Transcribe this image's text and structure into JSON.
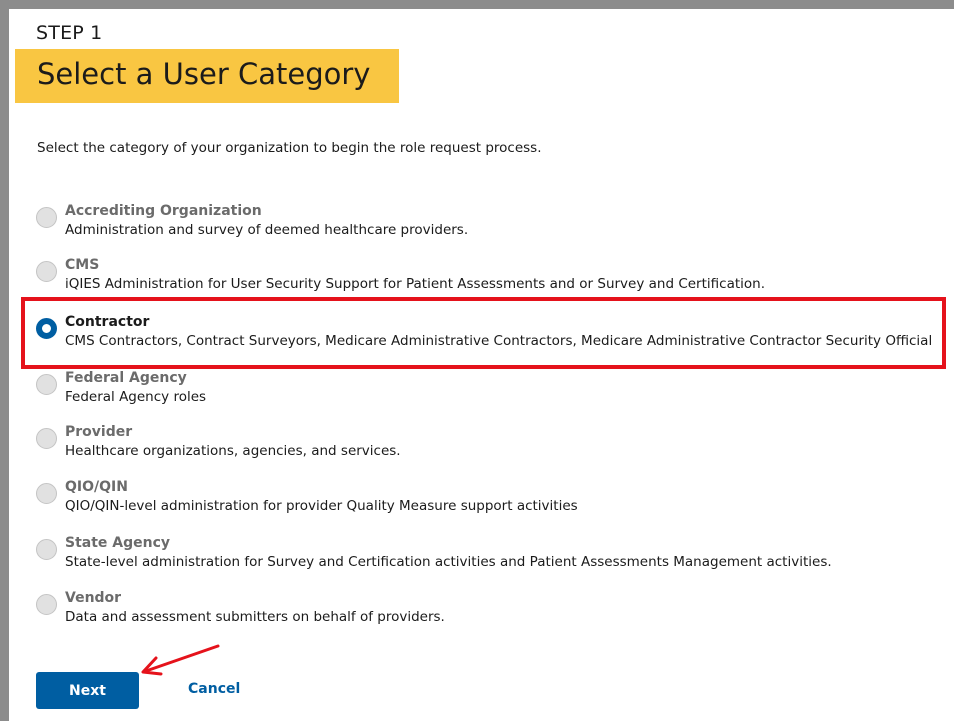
{
  "header": {
    "step": "STEP 1",
    "title": "Select a User Category"
  },
  "intro": "Select the category of your organization to begin the role request process.",
  "selected": "Contractor",
  "categories": [
    {
      "label": "Accrediting Organization",
      "description": "Administration and survey of deemed healthcare providers."
    },
    {
      "label": "CMS",
      "description": "iQIES Administration for User Security Support for Patient Assessments and or Survey and Certification."
    },
    {
      "label": "Contractor",
      "description": "CMS Contractors, Contract Surveyors, Medicare Administrative Contractors, Medicare Administrative Contractor Security Official"
    },
    {
      "label": "Federal Agency",
      "description": "Federal Agency roles"
    },
    {
      "label": "Provider",
      "description": "Healthcare organizations, agencies, and services."
    },
    {
      "label": "QIO/QIN",
      "description": "QIO/QIN-level administration for provider Quality Measure support activities"
    },
    {
      "label": "State Agency",
      "description": "State-level administration for Survey and Certification activities and Patient Assessments Management activities."
    },
    {
      "label": "Vendor",
      "description": "Data and assessment submitters on behalf of providers."
    }
  ],
  "actions": {
    "next": "Next",
    "cancel": "Cancel"
  },
  "colors": {
    "title_highlight": "#f9c642",
    "primary": "#005ea2",
    "annotation": "#e5121b"
  }
}
